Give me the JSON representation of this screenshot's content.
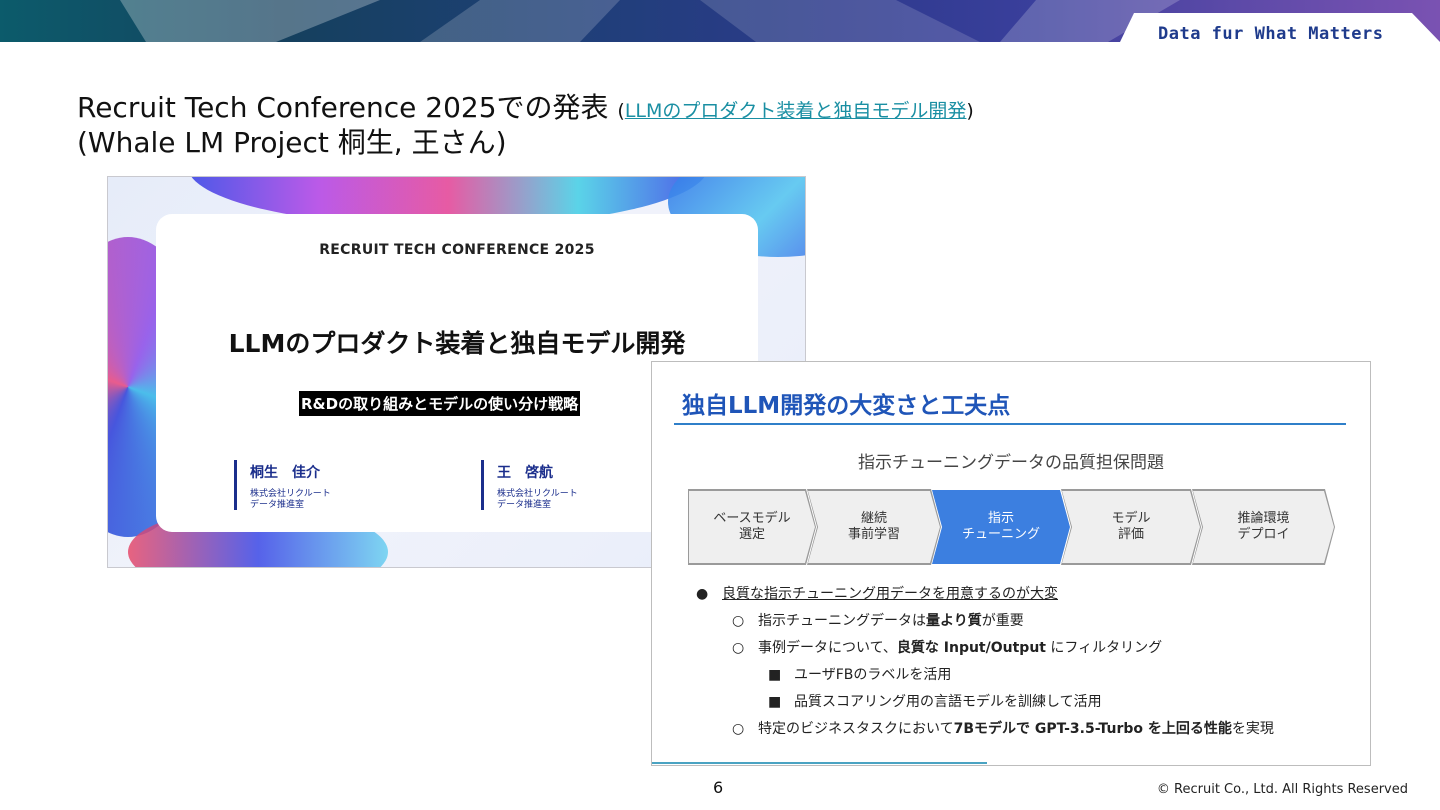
{
  "header": {
    "tagline": "Data fur What Matters",
    "colors": {
      "banner_start": "#0c5b6b",
      "banner_end": "#7a52b2",
      "tagline": "#1f3b8c"
    }
  },
  "title": {
    "main": "Recruit Tech Conference 2025での発表",
    "link_open_paren": "(",
    "link_text": "LLMのプロダクト装着と独自モデル開発",
    "link_close_paren": ")",
    "line2": "(Whale LM Project 桐生, 王さん)"
  },
  "cover_slide": {
    "conference": "RECRUIT TECH CONFERENCE 2025",
    "title": "LLMのプロダクト装着と独自モデル開発",
    "subtitle": "R&Dの取り組みとモデルの使い分け戦略",
    "speakers": [
      {
        "name": "桐生　佳介",
        "org": "株式会社リクルート\nデータ推進室"
      },
      {
        "name": "王　啓航",
        "org": "株式会社リクルート\nデータ推進室"
      }
    ]
  },
  "detail_slide": {
    "title": "独自LLM開発の大変さと工夫点",
    "subtitle": "指示チューニングデータの品質担保問題",
    "steps": [
      {
        "label": "ベースモデル\n選定",
        "active": false
      },
      {
        "label": "継続\n事前学習",
        "active": false
      },
      {
        "label": "指示\nチューニング",
        "active": true
      },
      {
        "label": "モデル\n評価",
        "active": false
      },
      {
        "label": "推論環境\nデプロイ",
        "active": false
      }
    ],
    "bullets": {
      "b1": {
        "mark": "●",
        "text": "良質な指示チューニング用データを用意するのが大変"
      },
      "b2": {
        "mark": "○",
        "pre": "指示チューニングデータは",
        "bold": "量より質",
        "post": "が重要"
      },
      "b3": {
        "mark": "○",
        "pre": "事例データについて、",
        "bold": "良質な Input/Output",
        "post": " にフィルタリング"
      },
      "b4": {
        "mark": "■",
        "text": "ユーザFBのラベルを活用"
      },
      "b5": {
        "mark": "■",
        "text": "品質スコアリング用の言語モデルを訓練して活用"
      },
      "b6": {
        "mark": "○",
        "pre": "特定のビジネスタスクにおいて",
        "bold1": "7Bモデルで GPT-3.5-Turbo を上回る性能",
        "post": "を実現"
      }
    },
    "colors": {
      "title": "#1f55b8",
      "active_step": "#3c7fe0",
      "rule": "#2f7fc9"
    }
  },
  "footer": {
    "page_number": "6",
    "copyright": "© Recruit Co., Ltd. All Rights Reserved"
  }
}
